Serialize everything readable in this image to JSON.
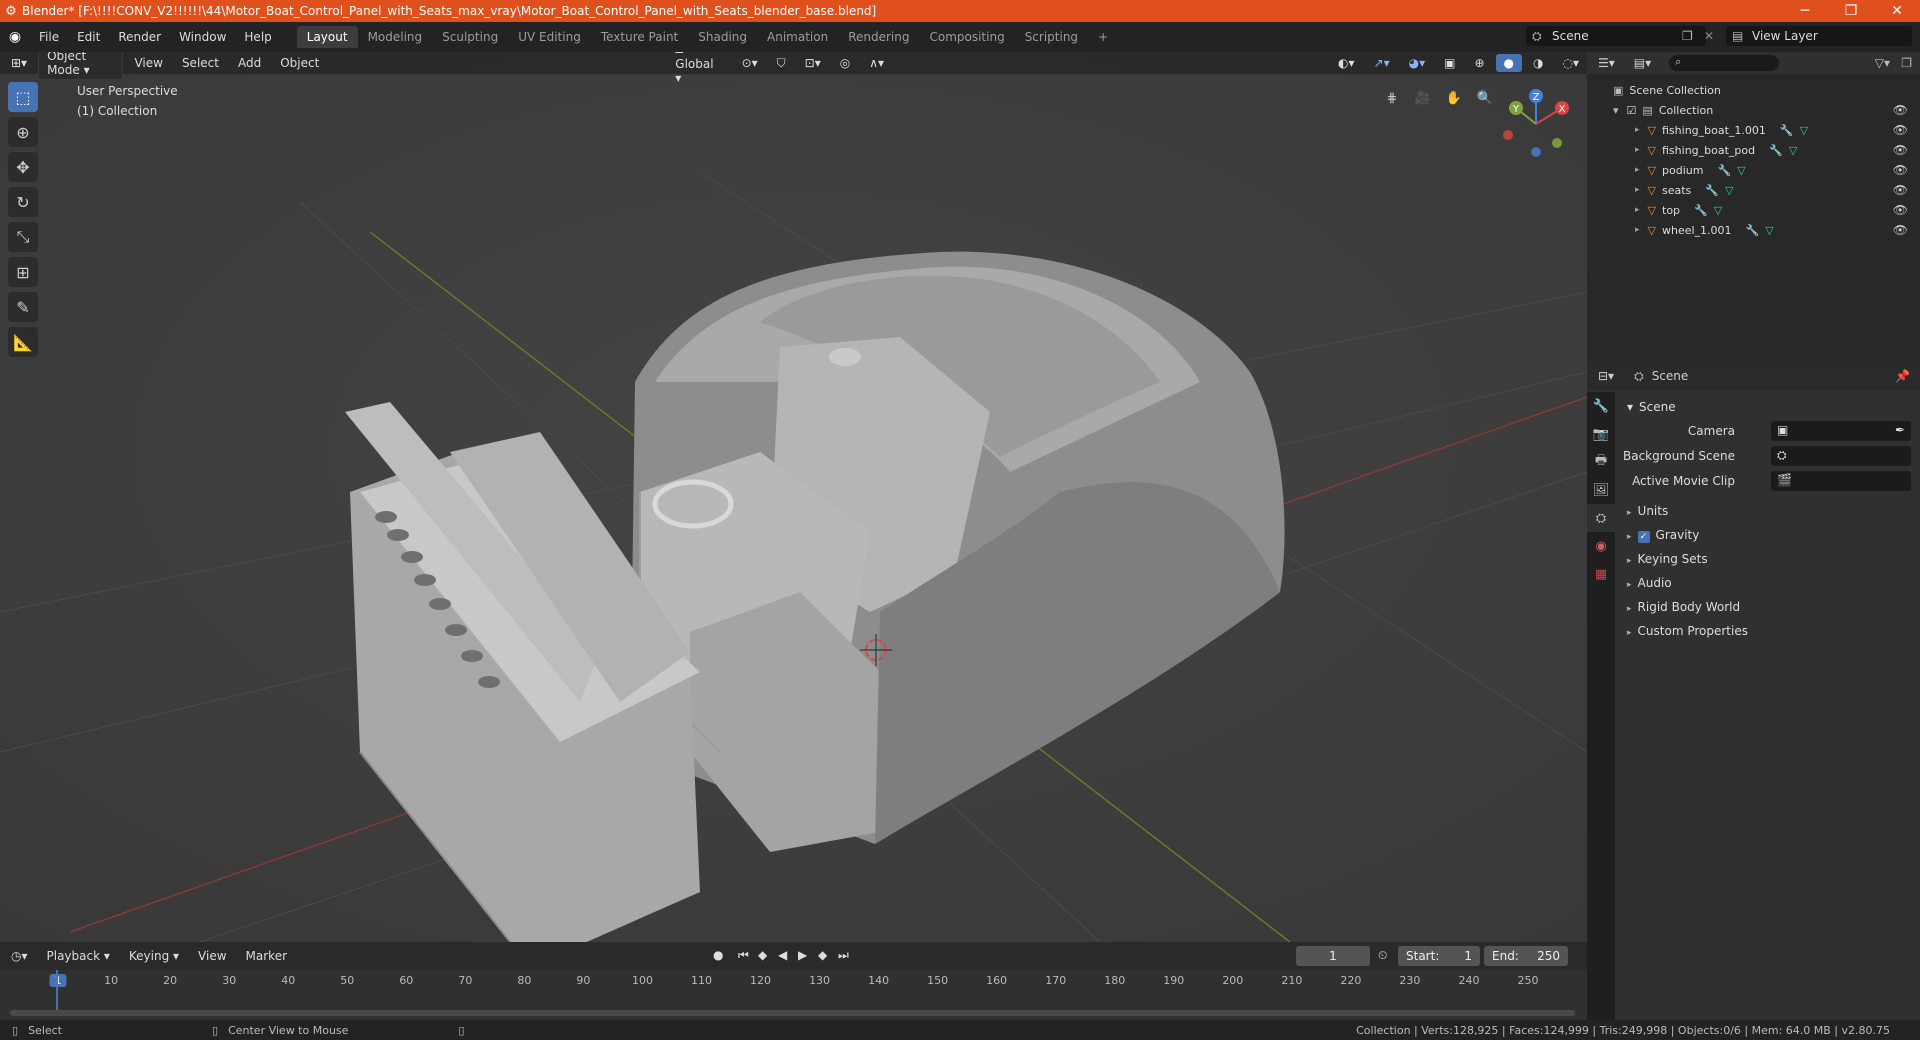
{
  "window": {
    "title": "Blender* [F:\\!!!!CONV_V2!!!!!!\\44\\Motor_Boat_Control_Panel_with_Seats_max_vray\\Motor_Boat_Control_Panel_with_Seats_blender_base.blend]",
    "minimize": "─",
    "maximize": "❐",
    "close": "✕"
  },
  "menu": [
    "File",
    "Edit",
    "Render",
    "Window",
    "Help"
  ],
  "workspaces": [
    "Layout",
    "Modeling",
    "Sculpting",
    "UV Editing",
    "Texture Paint",
    "Shading",
    "Animation",
    "Rendering",
    "Compositing",
    "Scripting"
  ],
  "add_workspace": "+",
  "scene": {
    "label": "Scene"
  },
  "view_layer": {
    "label": "View Layer"
  },
  "viewport": {
    "mode": "Object Mode",
    "menus": [
      "View",
      "Select",
      "Add",
      "Object"
    ],
    "transform_orientation": "Global",
    "perspective_label": "User Perspective",
    "collection_label": "(1) Collection",
    "gizmo": {
      "x": "X",
      "y": "Y",
      "z": "Z"
    }
  },
  "outliner": {
    "root": "Scene Collection",
    "collection": "Collection",
    "objects": [
      "fishing_boat_1.001",
      "fishing_boat_pod",
      "podium",
      "seats",
      "top",
      "wheel_1.001"
    ]
  },
  "properties": {
    "header": "Scene",
    "panel": "Scene",
    "fields": [
      {
        "label": "Camera"
      },
      {
        "label": "Background Scene"
      },
      {
        "label": "Active Movie Clip"
      }
    ],
    "sections": [
      {
        "label": "Units",
        "check": false
      },
      {
        "label": "Gravity",
        "check": true
      },
      {
        "label": "Keying Sets",
        "check": false
      },
      {
        "label": "Audio",
        "check": false
      },
      {
        "label": "Rigid Body World",
        "check": false
      },
      {
        "label": "Custom Properties",
        "check": false
      }
    ]
  },
  "timeline": {
    "menus": [
      "Playback",
      "Keying",
      "View",
      "Marker"
    ],
    "current_frame": "1",
    "start_label": "Start:",
    "start": "1",
    "end_label": "End:",
    "end": "250",
    "ticks": [
      "1",
      "10",
      "20",
      "30",
      "40",
      "50",
      "60",
      "70",
      "80",
      "90",
      "100",
      "110",
      "120",
      "130",
      "140",
      "150",
      "160",
      "170",
      "180",
      "190",
      "200",
      "210",
      "220",
      "230",
      "240",
      "250"
    ]
  },
  "status": {
    "left": "Select",
    "middle": "Center View to Mouse",
    "right": "Collection | Verts:128,925 | Faces:124,999 | Tris:249,998 | Objects:0/6 | Mem: 64.0 MB | v2.80.75"
  },
  "colors": {
    "title_bar": "#e0501c",
    "accent": "#4772b3",
    "object_icon": "#e8903c",
    "modifier_icon": "#5aa6e8",
    "mesh_icon": "#36c9a9"
  }
}
